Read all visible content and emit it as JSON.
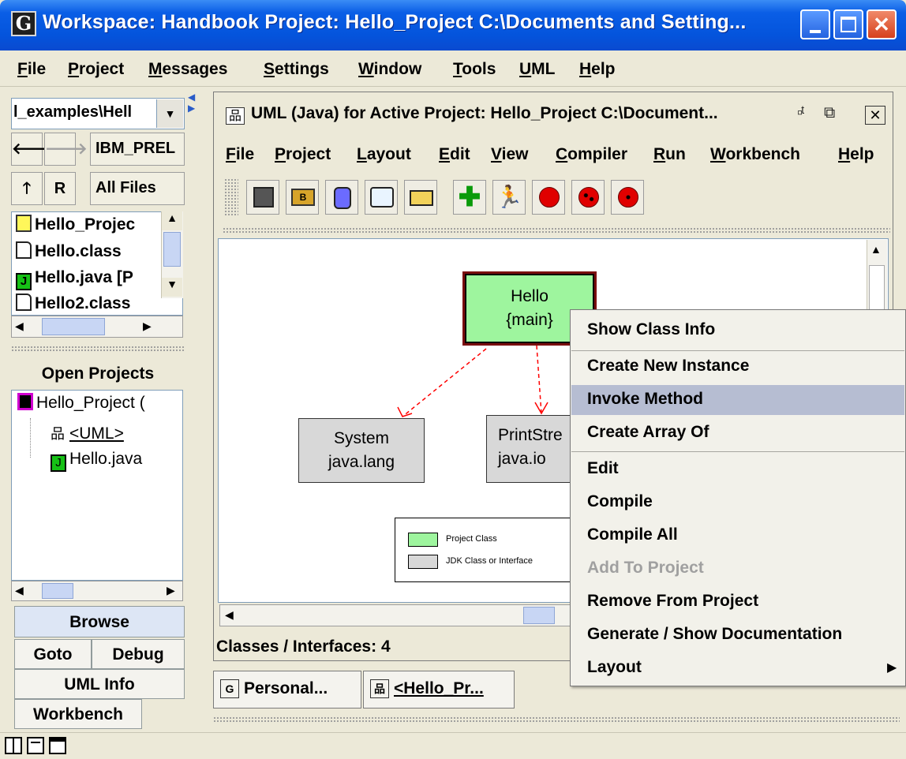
{
  "window": {
    "title": "Workspace: Handbook   Project: Hello_Project  C:\\Documents and Setting...",
    "app_icon": "G"
  },
  "menubar": [
    "File",
    "Project",
    "Messages",
    "Settings",
    "Window",
    "Tools",
    "UML",
    "Help"
  ],
  "left_panel": {
    "path_value": "l_examples\\Hell",
    "nav_field_1": "IBM_PREL",
    "refresh_label": "R",
    "filter_value": "All Files",
    "files": [
      {
        "name": "Hello_Projec",
        "icon": "folder-icon"
      },
      {
        "name": "Hello.class",
        "icon": "class-file-icon"
      },
      {
        "name": "Hello.java [P",
        "icon": "java-file-icon"
      },
      {
        "name": "Hello2.class",
        "icon": "class-file-icon"
      }
    ],
    "open_projects_title": "Open Projects",
    "tree": {
      "project": "Hello_Project  (",
      "uml": "<UML>",
      "java": "Hello.java",
      "java_badge": "J"
    },
    "tabs": {
      "browse": "Browse",
      "goto": "Goto",
      "debug": "Debug",
      "uml_info": "UML Info",
      "workbench": "Workbench"
    }
  },
  "uml_window": {
    "title": "UML (Java) for Active Project: Hello_Project  C:\\Document...",
    "menus": [
      "File",
      "Project",
      "Layout",
      "Edit",
      "View",
      "Compiler",
      "Run",
      "Workbench",
      "Help"
    ],
    "toolbar": [
      "save-icon",
      "bluej-icon",
      "jar-icon",
      "book-icon",
      "print-icon",
      "add-icon",
      "run-icon",
      "apple-icon",
      "ladybug-icon",
      "apple-bug-icon"
    ],
    "classes": {
      "hello_name": "Hello",
      "hello_sub": "{main}",
      "system_name": "System",
      "system_pkg": "java.lang",
      "printstream_name": "PrintStre",
      "printstream_pkg": "java.io"
    },
    "legend": {
      "project_class": "Project Class",
      "jdk_class": "JDK Class or Interface",
      "project_color": "#9ef59e",
      "jdk_color": "#d8d8d8"
    },
    "status": "Classes / Interfaces: 4"
  },
  "context_menu": {
    "show_class_info": "Show Class Info",
    "create_new_instance": "Create New Instance",
    "invoke_method": "Invoke Method",
    "create_array_of": "Create Array Of",
    "edit": "Edit",
    "compile": "Compile",
    "compile_all": "Compile All",
    "add_to_project": "Add To Project",
    "remove_from_project": "Remove From Project",
    "generate_docs": "Generate / Show Documentation",
    "layout": "Layout",
    "highlighted": "Invoke Method"
  },
  "desktop_tabs": {
    "personal": "Personal...",
    "hello": "<Hello_Pr..."
  },
  "colors": {
    "titlebar": "#0454dc",
    "highlight": "#b6bdd2",
    "project_class": "#9ef59e",
    "dependency_arrow": "#ff0000"
  }
}
